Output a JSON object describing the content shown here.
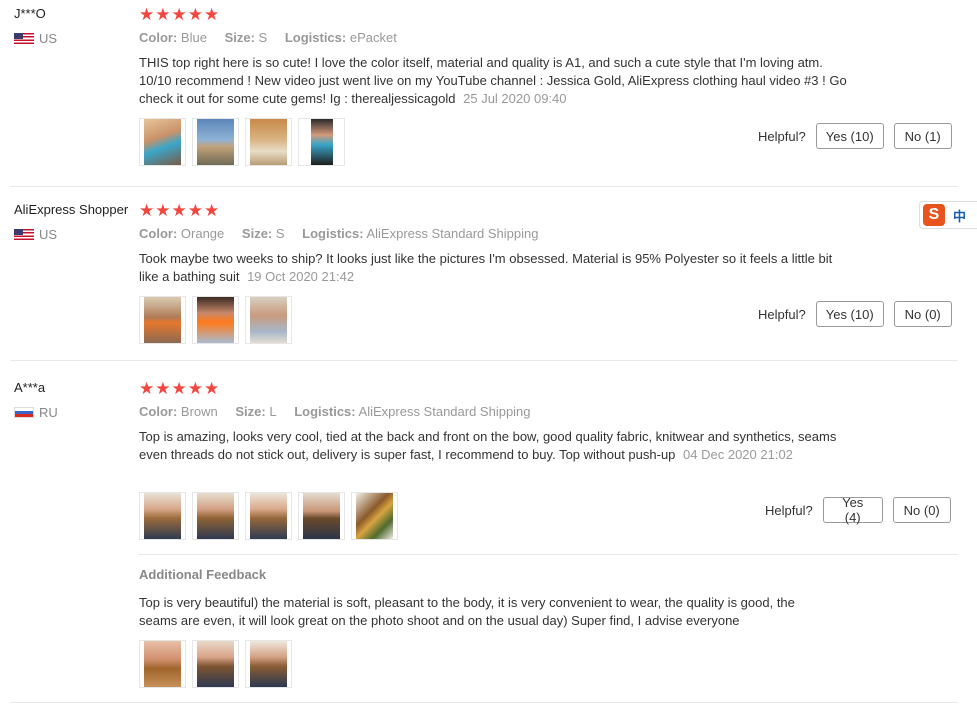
{
  "labels": {
    "color": "Color:",
    "size": "Size:",
    "logistics": "Logistics:",
    "helpful": "Helpful?",
    "additional_feedback": "Additional Feedback"
  },
  "reviews": [
    {
      "user": "J***O",
      "country": "US",
      "flag": "us",
      "rating": 5,
      "color": "Blue",
      "size": "S",
      "logistics": "ePacket",
      "text": "THIS top right here is so cute! I love the color itself, material and quality is A1, and such a cute style that I'm loving atm. 10/10 recommend ! New video just went live on my YouTube channel : Jessica Gold, AliExpress clothing haul video #3 ! Go check it out for some cute gems! Ig : therealjessicagold",
      "date": "25 Jul 2020 09:40",
      "yes": "Yes (10)",
      "no": "No (1)"
    },
    {
      "user": "AliExpress Shopper",
      "country": "US",
      "flag": "us",
      "rating": 5,
      "color": "Orange",
      "size": "S",
      "logistics": "AliExpress Standard Shipping",
      "text": "Took maybe two weeks to ship? It looks just like the pictures I'm obsessed. Material is 95% Polyester so it feels a little bit like a bathing suit",
      "date": "19 Oct 2020 21:42",
      "yes": "Yes (10)",
      "no": "No (0)"
    },
    {
      "user": "A***a",
      "country": "RU",
      "flag": "ru",
      "rating": 5,
      "color": "Brown",
      "size": "L",
      "logistics": "AliExpress Standard Shipping",
      "text": "Top is amazing, looks very cool, tied at the back and front on the bow, good quality fabric, knitwear and synthetics, seams even threads do not stick out, delivery is super fast, I recommend to buy. Top without push-up",
      "date": "04 Dec 2020 21:02",
      "yes": "Yes (4)",
      "no": "No (0)",
      "additional": "Top is very beautiful) the material is soft, pleasant to the body, it is very convenient to wear, the quality is good, the seams are even, it will look great on the photo shoot and on the usual day) Super find, I advise everyone"
    }
  ],
  "ime": {
    "logo": "S",
    "lang": "中"
  },
  "colors": {
    "star": "#f2473f",
    "muted": "#999999",
    "text": "#333333"
  }
}
